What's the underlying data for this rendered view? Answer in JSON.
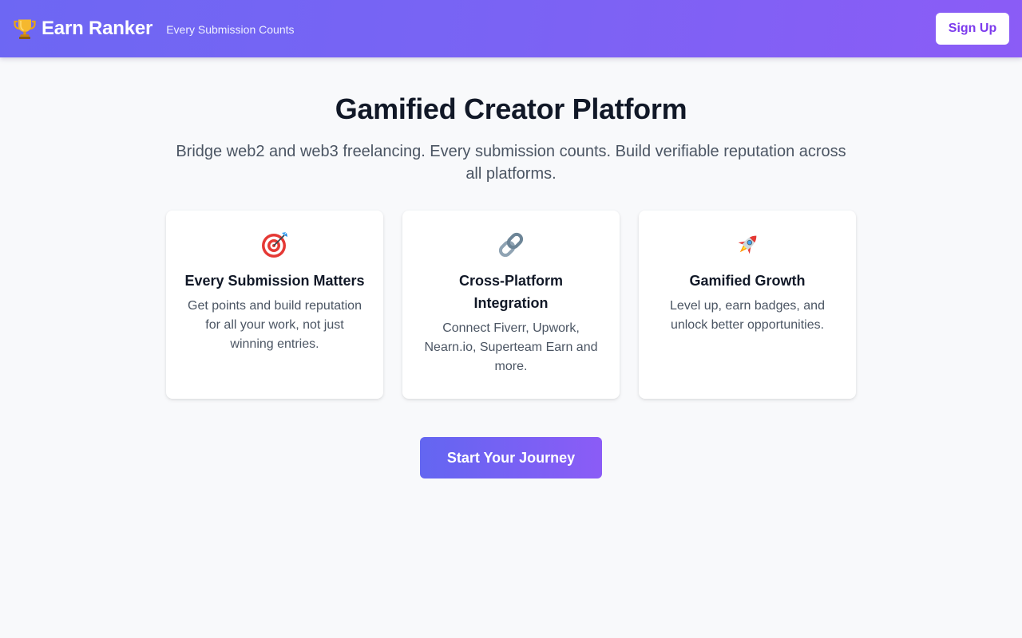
{
  "header": {
    "brand_name": "Earn Ranker",
    "tagline": "Every Submission Counts",
    "brand_icon": "trophy-icon",
    "signup_label": "Sign Up"
  },
  "hero": {
    "title": "Gamified Creator Platform",
    "subtitle": "Bridge web2 and web3 freelancing. Every submission counts. Build verifiable reputation across all platforms."
  },
  "features": [
    {
      "icon": "target-icon",
      "title": "Every Submission Matters",
      "description": "Get points and build reputation for all your work, not just winning entries."
    },
    {
      "icon": "link-icon",
      "title": "Cross-Platform Integration",
      "description": "Connect Fiverr, Upwork, Nearn.io, Superteam Earn and more."
    },
    {
      "icon": "rocket-icon",
      "title": "Gamified Growth",
      "description": "Level up, earn badges, and unlock better opportunities."
    }
  ],
  "cta": {
    "label": "Start Your Journey"
  },
  "colors": {
    "header_gradient_start": "#6d67f3",
    "header_gradient_end": "#8b5cf6",
    "accent": "#7c3aed",
    "background": "#f8f9fb"
  }
}
